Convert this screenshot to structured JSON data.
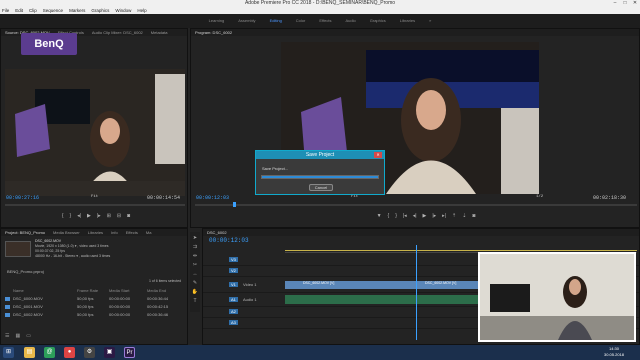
{
  "window": {
    "title": "Adobe Premiere Pro CC 2018 - D:\\BENQ_SEMINAR\\BENQ_Promo",
    "min": "–",
    "max": "□",
    "close": "✕"
  },
  "menu": [
    "File",
    "Edit",
    "Clip",
    "Sequence",
    "Markers",
    "Graphics",
    "Window",
    "Help"
  ],
  "workspaces": [
    "Learning",
    "Assembly",
    "Editing",
    "Color",
    "Effects",
    "Audio",
    "Graphics",
    "Libraries",
    "»"
  ],
  "workspace_active": "Editing",
  "source": {
    "tabs": [
      "Source: DSC_6002.MOV",
      "Effect Controls",
      "Audio Clip Mixer: DSC_6002",
      "Metadata"
    ],
    "logo": "BenQ",
    "timecode_left": "00:00:27:16",
    "fit": "Fit",
    "timecode_right": "00:00:14:54"
  },
  "program": {
    "tab": "Program: DSC_6002",
    "timecode_left": "00:00:12:03",
    "fit": "Fit",
    "zoom": "1/2",
    "timecode_right": "00:02:18:30"
  },
  "dialog": {
    "title": "Save Project",
    "status": "Save Project...",
    "progress": 1.0,
    "cancel": "Cancel",
    "close": "✕"
  },
  "project": {
    "tabs": [
      "Project: BENQ_Promo",
      "Media Browser",
      "Libraries",
      "Info",
      "Effects",
      "Ma"
    ],
    "clip_name": "DSC_6002.MOV",
    "clip_meta": [
      "Movie, 1920 x 1080 (1.0) ▾ , video used 3 times",
      "00:00:37:02, 25 fps",
      "48000 Hz - 16-bit - Stereo ▾ , audio used 3 times"
    ],
    "bin": "BENQ_Promo.prproj",
    "items_selected": "1 of 6 items selected",
    "columns": [
      "Name",
      "Frame Rate",
      "Media Start",
      "Media End"
    ],
    "rows": [
      {
        "name": "DSC_6000.MOV",
        "fps": "50,00 fps",
        "start": "00:00:00:00",
        "end": "00:00:36:44"
      },
      {
        "name": "DSC_6001.MOV",
        "fps": "50,00 fps",
        "start": "00:00:00:00",
        "end": "00:00:42:15"
      },
      {
        "name": "DSC_6002.MOV",
        "fps": "50,00 fps",
        "start": "00:00:00:00",
        "end": "00:00:36:46"
      }
    ]
  },
  "timeline": {
    "tab": "DSC_6002",
    "timecode": "00:00:12:03",
    "tracks": [
      {
        "label": "V3",
        "name": ""
      },
      {
        "label": "V2",
        "name": ""
      },
      {
        "label": "V1",
        "name": "Video 1"
      },
      {
        "label": "A1",
        "name": "Audio 1"
      },
      {
        "label": "A2",
        "name": ""
      },
      {
        "label": "A3",
        "name": ""
      }
    ],
    "clip1": "DSC_6002.MOV [V]",
    "clip2": "DSC_6002.MOV [V]"
  },
  "clock": {
    "time": "14:30",
    "date": "30.05.2018"
  },
  "colors": {
    "accent": "#3ba1ff",
    "dialog_header": "#1e8fb5",
    "benq_purple": "#5b3c8f"
  }
}
